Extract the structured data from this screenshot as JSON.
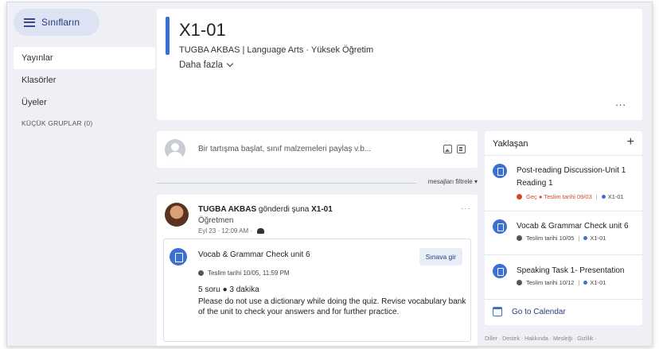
{
  "sidebar": {
    "classes_button": "Sınıfların",
    "items": [
      {
        "label": "Yayınlar"
      },
      {
        "label": "Klasörler"
      },
      {
        "label": "Üyeler"
      }
    ],
    "subgroups": "KÜÇÜK GRUPLAR (0)"
  },
  "header": {
    "title": "X1-01",
    "subtitle": "TUGBA AKBAS | Language Arts  · Yüksek Öğretim",
    "more": "Daha fazla",
    "more_menu": "..."
  },
  "composer": {
    "placeholder": "Bir tartışma başlat, sınıf malzemeleri paylaş v.b..."
  },
  "feed": {
    "filter": "mesajları filtrele ▾"
  },
  "post": {
    "author": "TUGBA AKBAS",
    "action": " gönderdi şuna ",
    "target": "X1-01",
    "role": "Öğretmen",
    "date": "Eyl 23 · 12:09 AM ·",
    "menu": "···",
    "quiz": {
      "title": "Vocab & Grammar Check unit 6",
      "button": "Sınava gir",
      "due": "Teslim tarihi 10/05, 11:59 PM",
      "meta": "5 soru ● 3 dakika",
      "description": "Please do not use a dictionary while doing the quiz. Revise vocabulary bank of the unit to check your answers and for further practice."
    }
  },
  "upcoming": {
    "title": "Yaklaşan",
    "add": "+",
    "items": [
      {
        "title": "Post-reading Discussion-Unit 1 Reading 1",
        "status": "Geç ● Teslim tarihi 09/03",
        "class": "X1-01",
        "late": true
      },
      {
        "title": "Vocab & Grammar Check unit 6",
        "status": "Teslim tarihi 10/05",
        "class": "X1-01",
        "late": false
      },
      {
        "title": "Speaking Task 1- Presentation",
        "status": "Teslim tarihi 10/12",
        "class": "X1-01",
        "late": false
      }
    ],
    "calendar": "Go to Calendar"
  },
  "footer": "Diller · Destek · Hakkında · Mesleği · Gizlilik ·",
  "colors": {
    "accent": "#3b6fd1",
    "late": "#d34a2a",
    "background": "#eef0f5"
  }
}
